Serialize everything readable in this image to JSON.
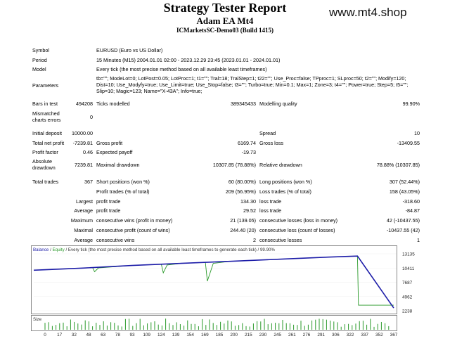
{
  "watermark": "www.mt4.shop",
  "header": {
    "title": "Strategy Tester Report",
    "ea_name": "Adam EA Mt4",
    "server": "ICMarketsSC-Demo03 (Build 1415)"
  },
  "info": {
    "symbol_label": "Symbol",
    "symbol_value": "EURUSD (Euro vs US Dollar)",
    "period_label": "Period",
    "period_value": "15 Minutes (M15) 2004.01.01 02:00 - 2023.12.29 23:45 (2023.01.01 - 2024.01.01)",
    "model_label": "Model",
    "model_value": "Every tick (the most precise method based on all available least timeframes)",
    "params_label": "Parameters",
    "params_value": "tb=\"\"; ModeLot=0; LotPost=0.05; LotProc=1; t1=\"\"; Tral=18; TralStep=1; t22=\"\"; Use_Proc=false; TPproc=1; SLproc=50; t2=\"\"; Modify=120; Dist=10; Use_Modyfy=true; Use_Limit=true; Use_Stop=false; t3=\"\"; Turbo=true; Min=0.1; Max=1; Zone=3; t4=\"\"; Power=true; Step=5; t5=\"\"; Slip=10; Magic=123; Name=\"X-43A\"; Info=true;"
  },
  "stats": {
    "bars_label": "Bars in test",
    "bars_value": "494208",
    "ticks_label": "Ticks modelled",
    "ticks_value": "389345433",
    "quality_label": "Modelling quality",
    "quality_value": "99.90%",
    "mismatch_label": "Mismatched charts errors",
    "mismatch_value": "0",
    "deposit_label": "Initial deposit",
    "deposit_value": "10000.00",
    "spread_label": "Spread",
    "spread_value": "10",
    "netprofit_label": "Total net profit",
    "netprofit_value": "-7239.81",
    "grossprofit_label": "Gross profit",
    "grossprofit_value": "6169.74",
    "grossloss_label": "Gross loss",
    "grossloss_value": "-13409.55",
    "pf_label": "Profit factor",
    "pf_value": "0.46",
    "payoff_label": "Expected payoff",
    "payoff_value": "-19.73",
    "absdd_label": "Absolute drawdown",
    "absdd_value": "7239.81",
    "maxdd_label": "Maximal drawdown",
    "maxdd_value": "10307.85 (78.88%)",
    "reldd_label": "Relative drawdown",
    "reldd_value": "78.88% (10307.85)",
    "trades_label": "Total trades",
    "trades_value": "367",
    "short_label": "Short positions (won %)",
    "short_value": "60 (80.00%)",
    "long_label": "Long positions (won %)",
    "long_value": "307 (52.44%)",
    "profit_trades_label": "Profit trades (% of total)",
    "profit_trades_value": "209 (56.95%)",
    "loss_trades_label": "Loss trades (% of total)",
    "loss_trades_value": "158 (43.05%)",
    "largest_label": "Largest",
    "largest_profit_label": "profit trade",
    "largest_profit_value": "134.30",
    "largest_loss_label": "loss trade",
    "largest_loss_value": "-318.60",
    "average_label": "Average",
    "avg_profit_label": "profit trade",
    "avg_profit_value": "29.52",
    "avg_loss_label": "loss trade",
    "avg_loss_value": "-84.87",
    "maximum_label": "Maximum",
    "max_cw_label": "consecutive wins (profit in money)",
    "max_cw_value": "21 (139.05)",
    "max_cl_label": "consecutive losses (loss in money)",
    "max_cl_value": "42 (-10437.55)",
    "maximal_label": "Maximal",
    "mxl_cp_label": "consecutive profit (count of wins)",
    "mxl_cp_value": "244.40 (20)",
    "mxl_cl_label": "consecutive loss (count of losses)",
    "mxl_cl_value": "-10437.55 (42)",
    "average2_label": "Average",
    "avg_cw_label": "consecutive wins",
    "avg_cw_value": "2",
    "avg_cl_label": "consecutive losses",
    "avg_cl_value": "1"
  },
  "chart_data": {
    "type": "line",
    "title": "Balance / Equity / Every tick (the most precise method based on all available least timeframes to generate each tick) / 99.90%",
    "title_parts": [
      "Balance",
      " / ",
      "Equity",
      " / Every tick (the most precise method based on all available least timeframes to generate each tick) / 99.90%"
    ],
    "colors": {
      "balance": "#1c1ca8",
      "equity": "#2a9a2a",
      "size": "#2a9a2a"
    },
    "ytick_labels": [
      "13135",
      "10411",
      "7687",
      "4962",
      "2238"
    ],
    "ylim": [
      2238,
      13135
    ],
    "xlim": [
      0,
      367
    ],
    "xtick_labels": [
      "0",
      "17",
      "32",
      "48",
      "63",
      "78",
      "93",
      "109",
      "124",
      "139",
      "154",
      "169",
      "185",
      "200",
      "215",
      "230",
      "245",
      "261",
      "276",
      "291",
      "306",
      "322",
      "337",
      "352",
      "367"
    ],
    "size_label": "Size",
    "series": [
      {
        "name": "Balance",
        "x": [
          0,
          50,
          100,
          150,
          200,
          250,
          300,
          330,
          367
        ],
        "values": [
          10000,
          10400,
          10900,
          11300,
          11700,
          12100,
          12500,
          12700,
          2760
        ]
      },
      {
        "name": "Equity",
        "x": [
          0,
          50,
          60,
          62,
          66,
          100,
          130,
          132,
          136,
          150,
          175,
          177,
          183,
          200,
          250,
          300,
          330,
          331,
          367
        ],
        "values": [
          10000,
          10400,
          10480,
          9700,
          10450,
          10900,
          11170,
          9500,
          11000,
          11300,
          11500,
          7900,
          11300,
          11700,
          12100,
          12500,
          12700,
          3300,
          3300
        ]
      }
    ]
  }
}
